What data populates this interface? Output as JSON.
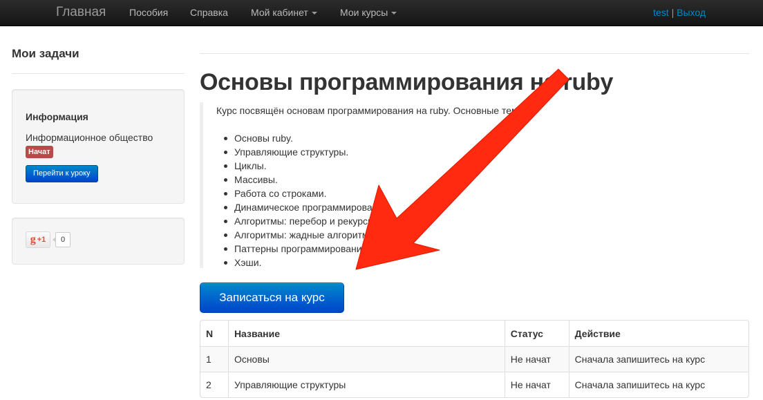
{
  "navbar": {
    "brand": "Главная",
    "items": [
      {
        "label": "Пособия"
      },
      {
        "label": "Справка"
      },
      {
        "label": "Мой кабинет"
      },
      {
        "label": "Мои курсы"
      }
    ],
    "user": "test",
    "separator": "|",
    "logout": "Выход"
  },
  "sidebar": {
    "title": "Мои задачи",
    "info": {
      "title": "Информация",
      "text": "Информационное общество",
      "badge": "Начат",
      "button": "Перейти к уроку"
    },
    "gplus": {
      "g": "g",
      "plus": "+1",
      "count": "0"
    }
  },
  "main": {
    "title": "Основы программирования на ruby",
    "description": "Курс посвящён основам программирования на ruby. Основные темы:",
    "topics": [
      "Основы ruby.",
      "Управляющие структуры.",
      "Циклы.",
      "Массивы.",
      "Работа со строками.",
      "Динамическое программирование.",
      "Алгоритмы: перебор и рекурсия.",
      "Алгоритмы: жадные алгоритмы.",
      "Паттерны программирования.",
      "Хэши."
    ],
    "enroll_button": "Записаться на курс",
    "table": {
      "headers": [
        "N",
        "Название",
        "Статус",
        "Действие"
      ],
      "rows": [
        [
          "1",
          "Основы",
          "Не начат",
          "Сначала запишитесь на курс"
        ],
        [
          "2",
          "Управляющие структуры",
          "Не начат",
          "Сначала запишитесь на курс"
        ]
      ]
    }
  },
  "colors": {
    "navbar_bg": "#1b1b1b",
    "link": "#0088cc",
    "badge": "#b94a48",
    "button_primary": "#0055cc",
    "arrow": "#ff2a0f"
  }
}
